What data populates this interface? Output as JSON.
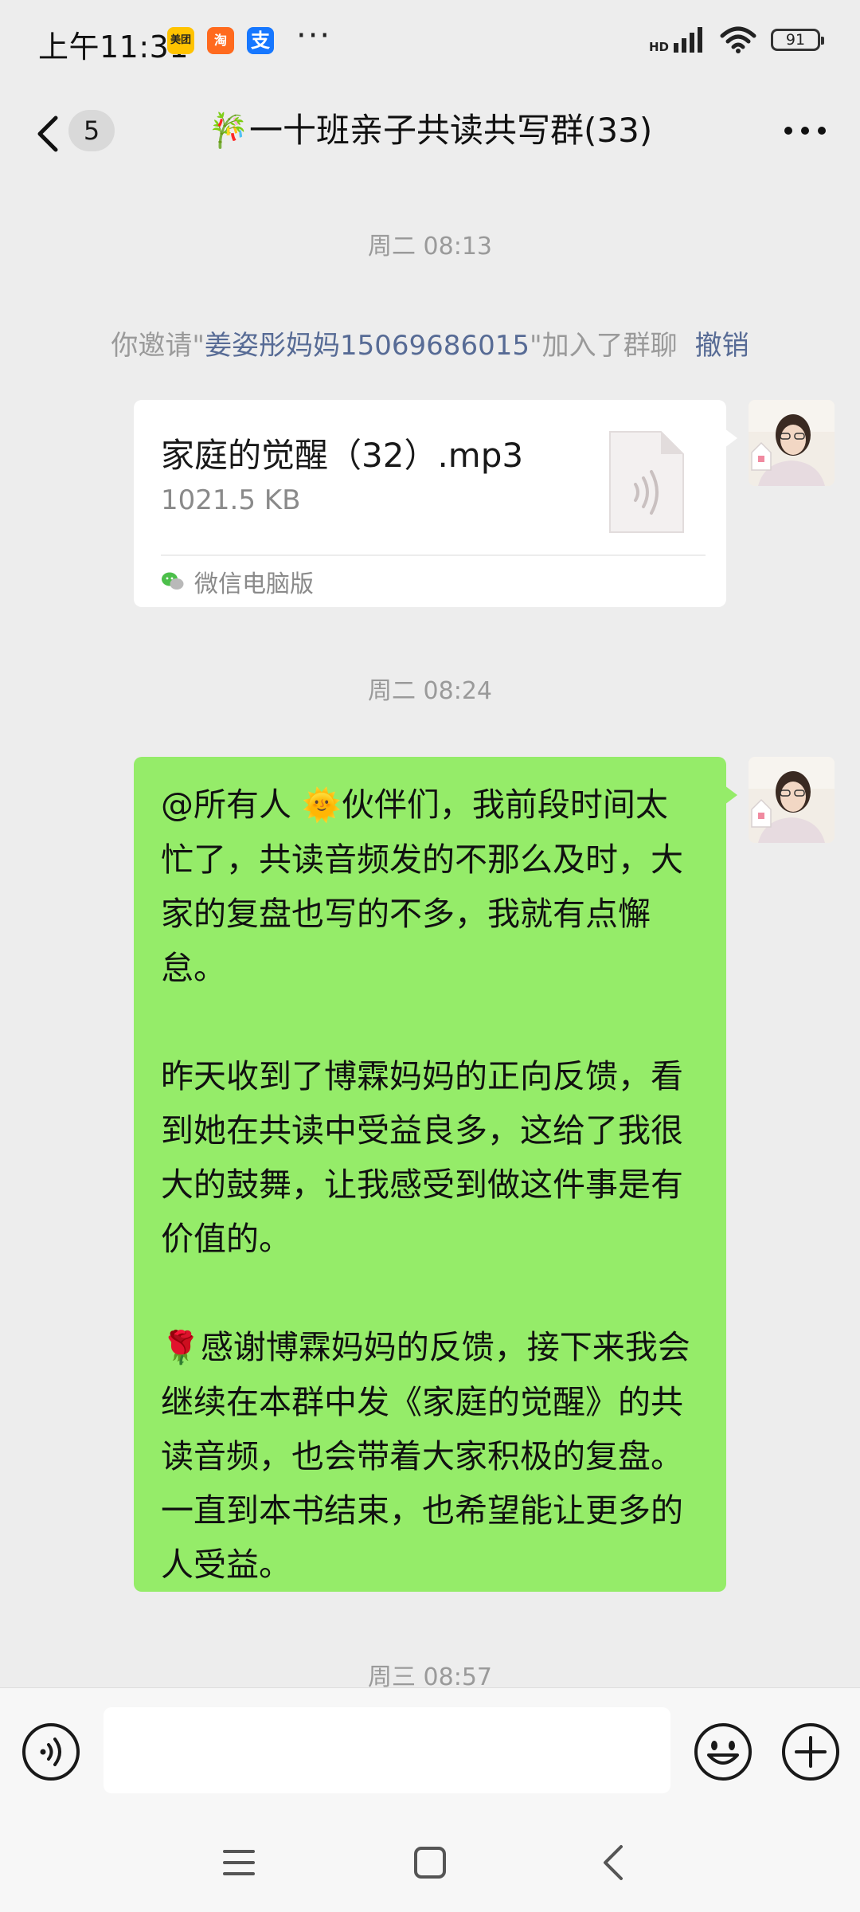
{
  "status_bar": {
    "time": "上午11:31",
    "app_icons": [
      {
        "name": "meituan-icon",
        "label": "美团",
        "color": "#ffc300"
      },
      {
        "name": "taobao-icon",
        "label": "淘",
        "color": "#ff6a1e"
      },
      {
        "name": "alipay-icon",
        "label": "支",
        "color": "#1677ff"
      }
    ],
    "more": "···",
    "network": "HD",
    "battery": "91"
  },
  "nav": {
    "unread_count": "5",
    "title": "一十班亲子共读共写群(33)",
    "title_emoji": "🎋"
  },
  "chat": {
    "timestamps": [
      "周二 08:13",
      "周二 08:24",
      "周三 08:57"
    ],
    "system_message": {
      "prefix": "你邀请\"",
      "name": "姜姿彤妈妈15069686015",
      "suffix": "\"加入了群聊",
      "action": "撤销"
    },
    "file_message": {
      "file_name": "家庭的觉醒（32）.mp3",
      "file_size": "1021.5 KB",
      "source": "微信电脑版"
    },
    "text_message": {
      "mention": "@所有人",
      "emoji_sun": "🌞",
      "para1_rest": "伙伴们，我前段时间太忙了，共读音频发的不那么及时，大家的复盘也写的不多，我就有点懈怠。",
      "para2": "昨天收到了博霖妈妈的正向反馈，看到她在共读中受益良多，这给了我很大的鼓舞，让我感受到做这件事是有价值的。",
      "emoji_rose": "🌹",
      "para3_rest": "感谢博霖妈妈的反馈，接下来我会继续在本群中发《家庭的觉醒》的共读音频，也会带着大家积极的复盘。一直到本书结束，也希望能让更多的人受益。"
    }
  },
  "input_bar": {
    "placeholder": ""
  },
  "colors": {
    "bubble_green": "#95ec69",
    "link_blue": "#576b95",
    "background": "#ededed"
  }
}
